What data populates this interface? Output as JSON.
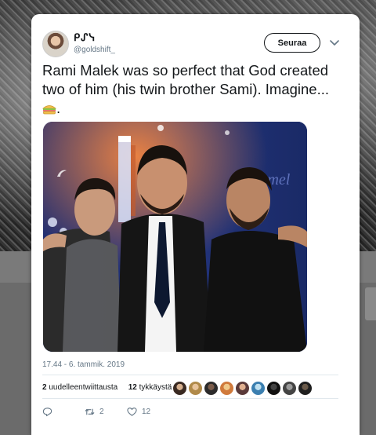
{
  "user": {
    "display_name": "ᑭᔑᓭ",
    "handle": "@goldshift_"
  },
  "follow_button": "Seuraa",
  "tweet": {
    "text": "Rami Malek was so perfect that God created two of him (his twin brother Sami). Imagine...",
    "trailing": "."
  },
  "timestamp": "17.44 - 6. tammik. 2019",
  "stats": {
    "retweets": "2",
    "retweets_label": "uudelleentwiittausta",
    "likes": "12",
    "likes_label": "tykkäystä"
  },
  "actions": {
    "retweet_count": "2",
    "like_count": "12"
  },
  "icons": [
    "chevron-down-icon",
    "sandwich-emoji-icon",
    "reply-icon",
    "retweet-icon",
    "heart-icon"
  ],
  "colors": {
    "text": "#14171a",
    "secondary": "#657786",
    "divider": "#e1e8ed"
  }
}
